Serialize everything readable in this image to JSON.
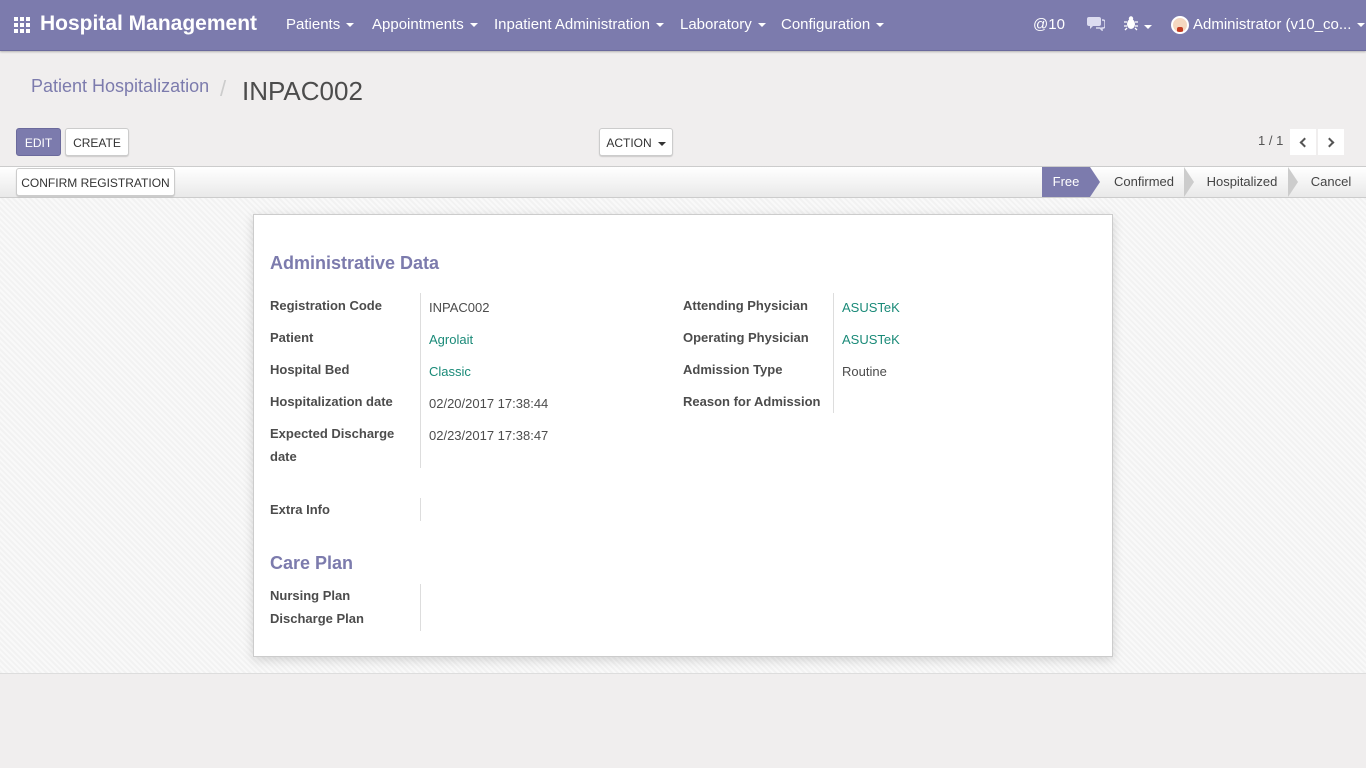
{
  "navbar": {
    "brand": "Hospital Management",
    "menus": [
      "Patients",
      "Appointments",
      "Inpatient Administration",
      "Laboratory",
      "Configuration"
    ],
    "messages_count": "10",
    "user_label": "Administrator (v10_co..."
  },
  "breadcrumb": {
    "parent": "Patient Hospitalization",
    "current": "INPAC002"
  },
  "toolbar": {
    "edit_label": "EDIT",
    "create_label": "CREATE",
    "action_label": "ACTION",
    "pager": "1 / 1"
  },
  "statusbar": {
    "confirm_label": "CONFIRM REGISTRATION",
    "steps": [
      "Free",
      "Confirmed",
      "Hospitalized",
      "Cancel"
    ],
    "active_step": "Free"
  },
  "form": {
    "admin_title": "Administrative Data",
    "registration_code": {
      "label": "Registration Code",
      "value": "INPAC002"
    },
    "patient": {
      "label": "Patient",
      "value": "Agrolait"
    },
    "hospital_bed": {
      "label": "Hospital Bed",
      "value": "Classic"
    },
    "hospitalization_date": {
      "label": "Hospitalization date",
      "value": "02/20/2017 17:38:44"
    },
    "expected_discharge": {
      "label_line1": "Expected Discharge",
      "label_line2": "date",
      "value": "02/23/2017 17:38:47"
    },
    "attending_physician": {
      "label": "Attending Physician",
      "value": "ASUSTeK"
    },
    "operating_physician": {
      "label": "Operating Physician",
      "value": "ASUSTeK"
    },
    "admission_type": {
      "label": "Admission Type",
      "value": "Routine"
    },
    "reason_for_admission": {
      "label": "Reason for Admission",
      "value": ""
    },
    "extra_info": {
      "label": "Extra Info",
      "value": ""
    },
    "care_title": "Care Plan",
    "nursing_plan": {
      "label": "Nursing Plan",
      "value": ""
    },
    "discharge_plan": {
      "label": "Discharge Plan",
      "value": ""
    }
  },
  "colors": {
    "brand": "#7c7bad",
    "link": "#1a8a78"
  }
}
